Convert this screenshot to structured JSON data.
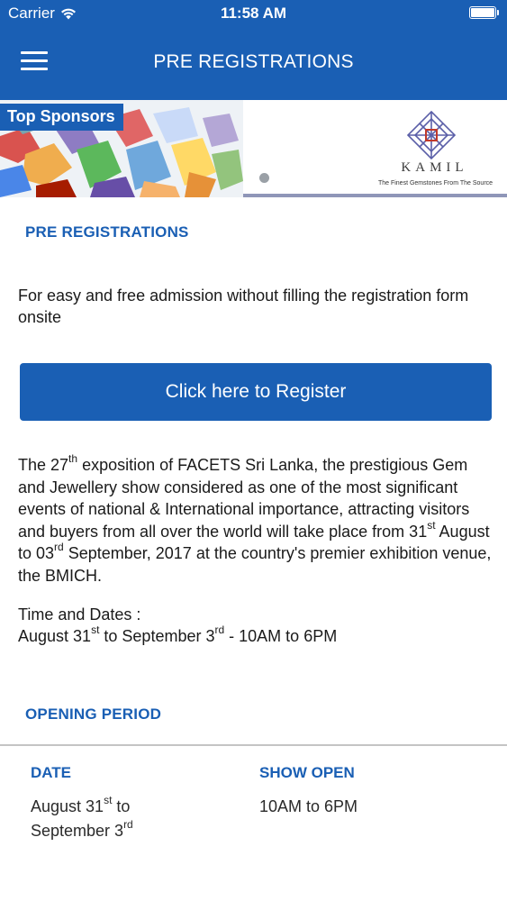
{
  "status_bar": {
    "carrier": "Carrier",
    "time": "11:58 AM"
  },
  "nav": {
    "title": "PRE REGISTRATIONS",
    "menu_icon": "hamburger-menu-icon"
  },
  "sponsors": {
    "label": "Top Sponsors",
    "sponsor_name": "KAMIL",
    "sponsor_tagline": "The Finest Gemstones From The Source",
    "carousel_pages": 1
  },
  "pre_registrations": {
    "heading": "PRE REGISTRATIONS",
    "intro": "For easy and free admission without filling the registration form onsite",
    "register_button": "Click here to Register"
  },
  "description": {
    "p1": "The 27",
    "p1_sup": "th",
    "p2": " exposition of FACETS Sri Lanka, the prestigious Gem and Jewellery show considered as one of the most significant events of national & International importance, attracting visitors and buyers from all over the world will take place from 31",
    "p2_sup": "st",
    "p3": " August to 03",
    "p3_sup": "rd",
    "p4": " September, 2017 at the country's premier exhibition venue, the BMICH."
  },
  "time_dates": {
    "label": "Time and Dates :",
    "d1": "August 31",
    "d1_sup": "st",
    "d2": " to September 3",
    "d2_sup": "rd",
    "d3": " - 10AM to 6PM"
  },
  "opening_period": {
    "heading": "OPENING PERIOD",
    "col_date": "DATE",
    "col_show": "SHOW OPEN",
    "date_a": "August 31",
    "date_a_sup": "st",
    "date_b": " to",
    "date_c": "September 3",
    "date_c_sup": "rd",
    "show_open": "10AM to 6PM"
  },
  "colors": {
    "primary": "#1a5fb4",
    "text": "#1a1a1a",
    "divider": "#c4c4c4"
  }
}
